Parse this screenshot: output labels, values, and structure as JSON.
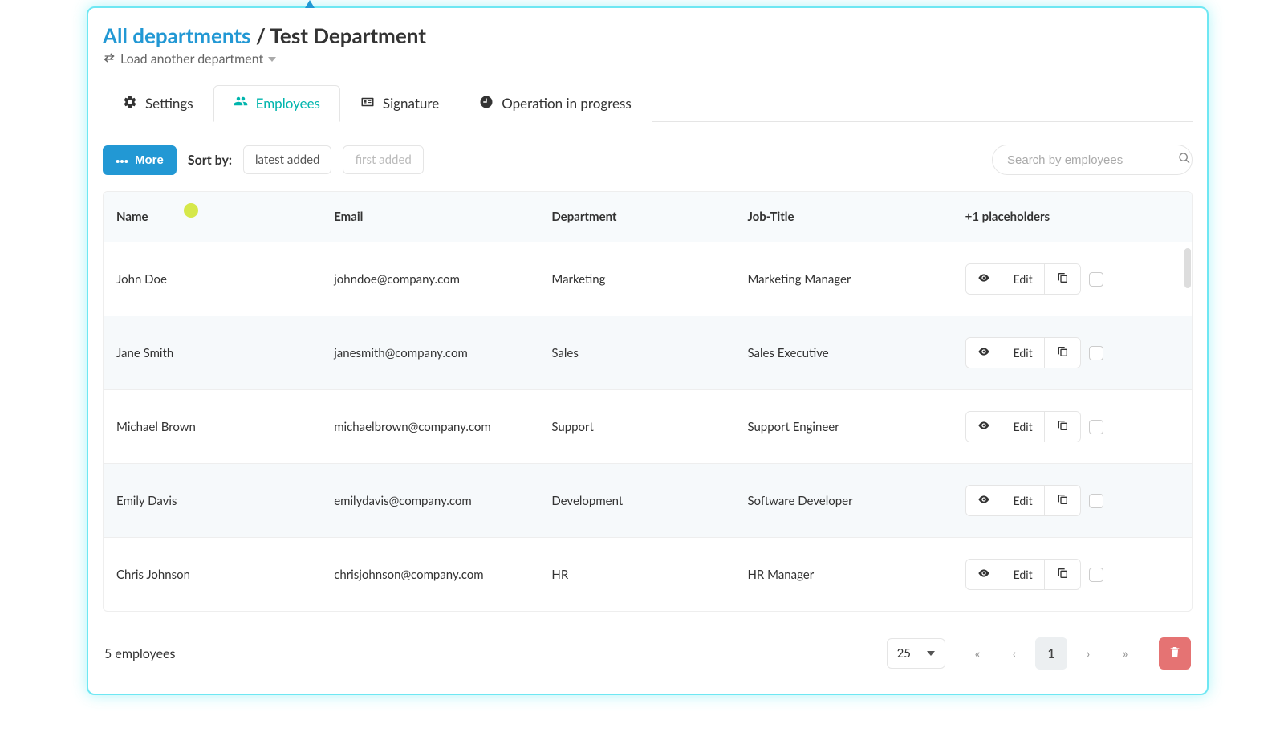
{
  "breadcrumb": {
    "root": "All departments",
    "separator": "/",
    "current": "Test Department"
  },
  "loadAnother": "Load another department",
  "tabs": [
    {
      "label": "Settings"
    },
    {
      "label": "Employees"
    },
    {
      "label": "Signature"
    },
    {
      "label": "Operation in progress"
    }
  ],
  "activeTabIndex": 1,
  "toolbar": {
    "more": "More",
    "sortByLabel": "Sort by:",
    "sortOptions": [
      "latest added",
      "first added"
    ],
    "searchPlaceholder": "Search by employees"
  },
  "table": {
    "headers": [
      "Name",
      "Email",
      "Department",
      "Job-Title",
      "+1 placeholders"
    ],
    "editLabel": "Edit",
    "rows": [
      {
        "name": "John Doe",
        "email": "johndoe@company.com",
        "department": "Marketing",
        "job": "Marketing Manager"
      },
      {
        "name": "Jane Smith",
        "email": "janesmith@company.com",
        "department": "Sales",
        "job": "Sales Executive"
      },
      {
        "name": "Michael Brown",
        "email": "michaelbrown@company.com",
        "department": "Support",
        "job": "Support Engineer"
      },
      {
        "name": "Emily Davis",
        "email": "emilydavis@company.com",
        "department": "Development",
        "job": "Software Developer"
      },
      {
        "name": "Chris Johnson",
        "email": "chrisjohnson@company.com",
        "department": "HR",
        "job": "HR Manager"
      }
    ]
  },
  "footer": {
    "count": "5 employees",
    "perPage": "25",
    "currentPage": "1"
  }
}
